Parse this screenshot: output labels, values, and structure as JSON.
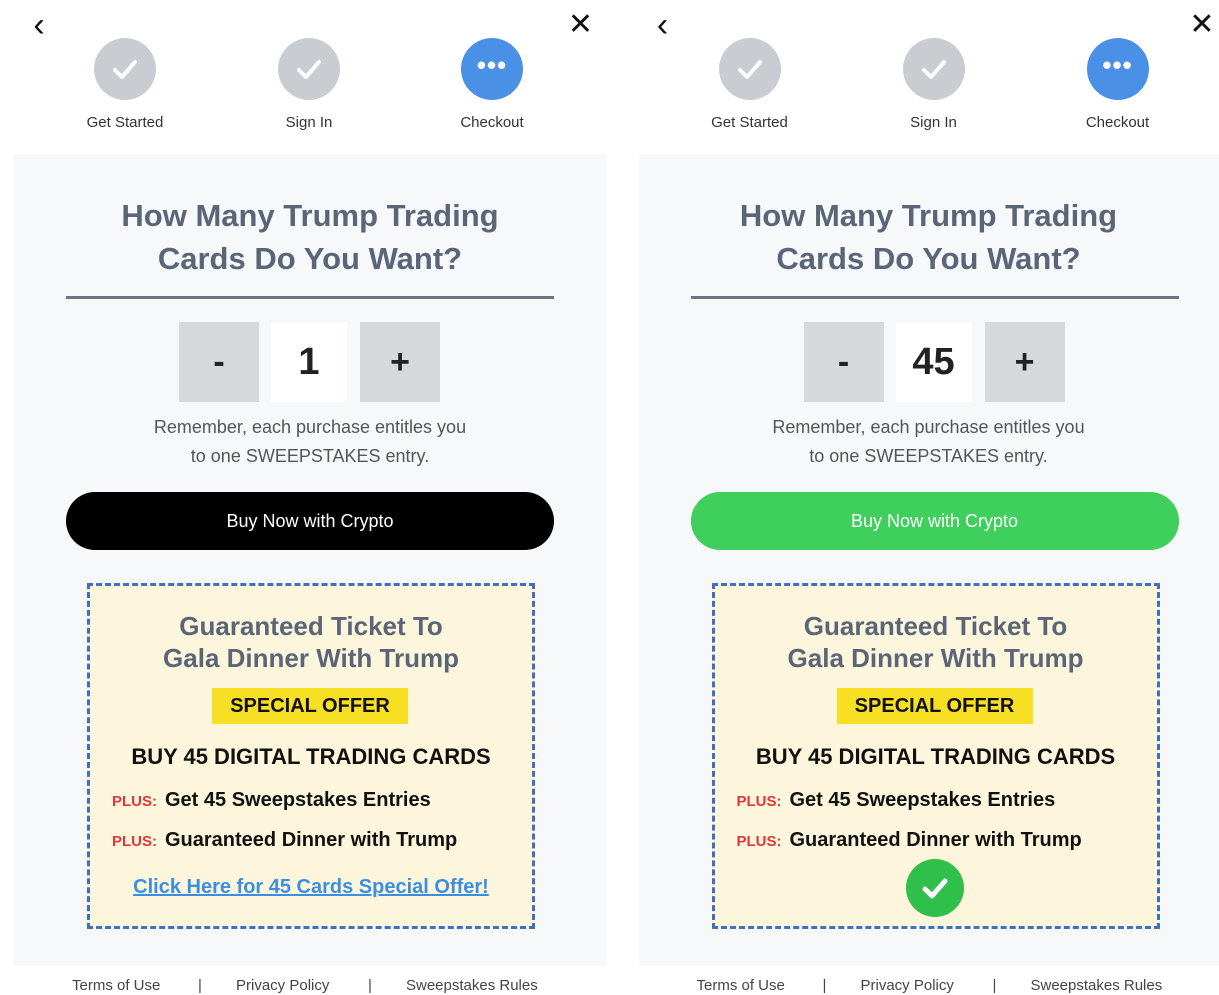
{
  "screens": [
    {
      "steps": [
        {
          "label": "Get Started",
          "state": "done"
        },
        {
          "label": "Sign In",
          "state": "done"
        },
        {
          "label": "Checkout",
          "state": "active"
        }
      ],
      "title_line1": "How Many Trump Trading",
      "title_line2": "Cards Do You Want?",
      "stepper": {
        "minus": "-",
        "quantity": "1",
        "plus": "+"
      },
      "reminder_line1": "Remember, each purchase entitles you",
      "reminder_line2": "to one SWEEPSTAKES entry.",
      "buy_button": {
        "label": "Buy Now with Crypto",
        "color": "#000000"
      },
      "offer": {
        "title_line1": "Guaranteed Ticket To",
        "title_line2": "Gala Dinner With Trump",
        "badge": "SPECIAL OFFER",
        "headline": "BUY 45 DIGITAL TRADING CARDS",
        "plus_label": "PLUS:",
        "line1": "Get 45 Sweepstakes Entries",
        "line2": "Guaranteed Dinner with Trump",
        "link": "Click Here for 45 Cards Special Offer!"
      },
      "footer": {
        "terms": "Terms of Use",
        "sep": "|",
        "privacy": "Privacy Policy",
        "rules": "Sweepstakes Rules"
      }
    },
    {
      "steps": [
        {
          "label": "Get Started",
          "state": "done"
        },
        {
          "label": "Sign In",
          "state": "done"
        },
        {
          "label": "Checkout",
          "state": "active"
        }
      ],
      "title_line1": "How Many Trump Trading",
      "title_line2": "Cards Do You Want?",
      "stepper": {
        "minus": "-",
        "quantity": "45",
        "plus": "+"
      },
      "reminder_line1": "Remember, each purchase entitles you",
      "reminder_line2": "to one SWEEPSTAKES entry.",
      "buy_button": {
        "label": "Buy Now with Crypto",
        "color": "#3ecf5c"
      },
      "offer": {
        "title_line1": "Guaranteed Ticket To",
        "title_line2": "Gala Dinner With Trump",
        "badge": "SPECIAL OFFER",
        "headline": "BUY 45 DIGITAL TRADING CARDS",
        "plus_label": "PLUS:",
        "line1": "Get 45 Sweepstakes Entries",
        "line2": "Guaranteed Dinner with Trump",
        "selected_icon": "check-icon"
      },
      "footer": {
        "terms": "Terms of Use",
        "sep": "|",
        "privacy": "Privacy Policy",
        "rules": "Sweepstakes Rules"
      }
    }
  ],
  "colors": {
    "step_done": "#c9ccd1",
    "step_active": "#4a90e6",
    "title": "#5a6678",
    "offer_border": "#3f6fc1",
    "offer_bg": "#fdf6dc",
    "badge": "#f7e024",
    "plus": "#e0363a",
    "link": "#3b8fe0",
    "check": "#2fbf4a"
  }
}
